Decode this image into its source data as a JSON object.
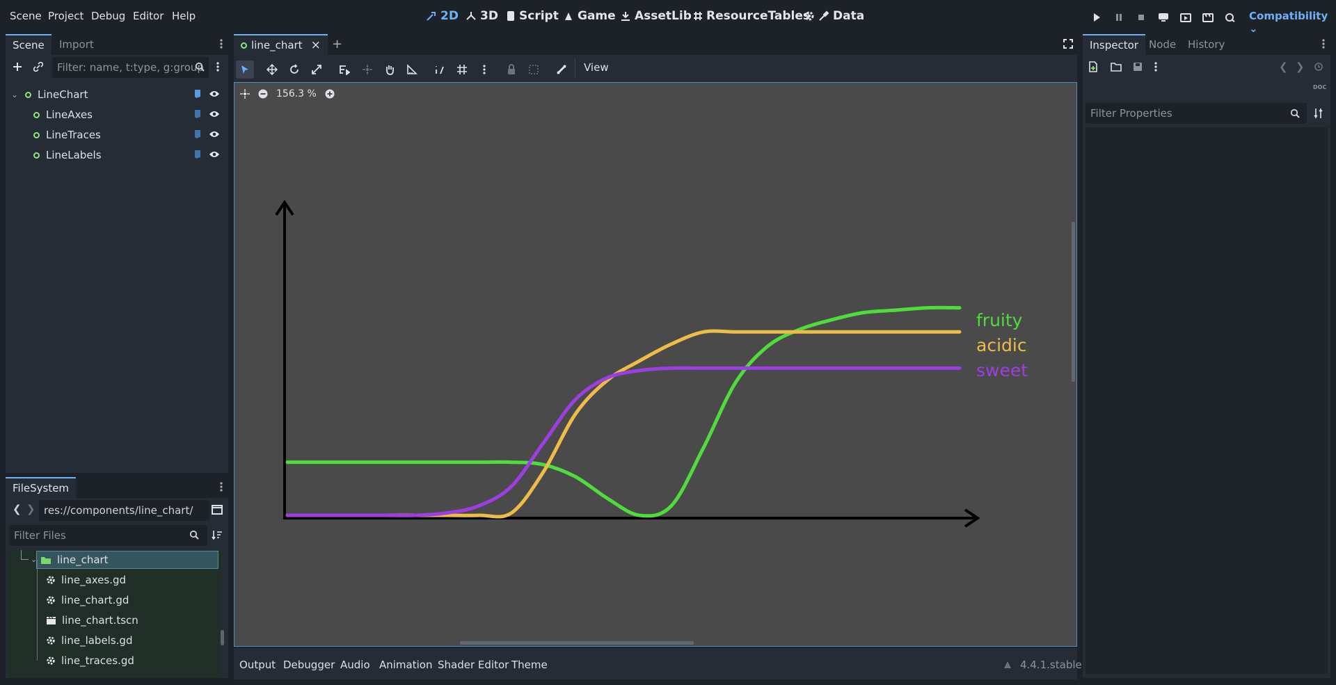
{
  "menu": [
    "Scene",
    "Project",
    "Debug",
    "Editor",
    "Help"
  ],
  "modes": [
    {
      "label": "2D",
      "icon": "2d-icon",
      "active": true
    },
    {
      "label": "3D",
      "icon": "3d-icon",
      "active": false
    },
    {
      "label": "Script",
      "icon": "script-icon",
      "active": false
    },
    {
      "label": "Game",
      "icon": "game-icon",
      "active": false
    },
    {
      "label": "AssetLib",
      "icon": "assetlib-icon",
      "active": false
    },
    {
      "label": "ResourceTables",
      "icon": "hash-icon",
      "active": false
    },
    {
      "label": "Data",
      "icon": "gear-icon",
      "active": false
    }
  ],
  "renderer": "Compatibility",
  "scene_panel": {
    "tabs": [
      "Scene",
      "Import"
    ],
    "filter_placeholder": "Filter: name, t:type, g:group",
    "tree": [
      {
        "label": "LineChart",
        "depth": 0
      },
      {
        "label": "LineAxes",
        "depth": 1
      },
      {
        "label": "LineTraces",
        "depth": 1
      },
      {
        "label": "LineLabels",
        "depth": 1
      }
    ]
  },
  "filesystem": {
    "tab": "FileSystem",
    "path": "res://components/line_chart/",
    "filter_placeholder": "Filter Files",
    "folder": "line_chart",
    "files": [
      {
        "name": "line_axes.gd",
        "icon": "gear-icon"
      },
      {
        "name": "line_chart.gd",
        "icon": "gear-icon"
      },
      {
        "name": "line_chart.tscn",
        "icon": "clapper-icon"
      },
      {
        "name": "line_labels.gd",
        "icon": "gear-icon"
      },
      {
        "name": "line_traces.gd",
        "icon": "gear-icon"
      }
    ]
  },
  "editor": {
    "scene_tab": "line_chart",
    "view_label": "View",
    "zoom": "156.3 %"
  },
  "inspector": {
    "tabs": [
      "Inspector",
      "Node",
      "History"
    ],
    "filter_placeholder": "Filter Properties"
  },
  "bottom_tabs": [
    "Output",
    "Debugger",
    "Audio",
    "Animation",
    "Shader Editor",
    "Theme"
  ],
  "version": "4.4.1.stable",
  "colors": {
    "accent": "#6fb1f5",
    "fruity": "#4fdc3c",
    "acidic": "#eebd47",
    "sweet": "#9c3ee2"
  },
  "chart_data": {
    "type": "line",
    "title": "",
    "xlabel": "",
    "ylabel": "",
    "legend_position": "right",
    "series": [
      {
        "name": "fruity",
        "color": "#4fdc3c",
        "values": [
          0.22,
          0.22,
          0.22,
          0.22,
          0.22,
          0.22,
          0.22,
          0.22,
          0.21,
          0.16,
          0.07,
          0.0,
          0.04,
          0.28,
          0.55,
          0.7,
          0.77,
          0.81,
          0.84,
          0.85,
          0.86,
          0.86
        ]
      },
      {
        "name": "acidic",
        "color": "#eebd47",
        "values": [
          0.0,
          0.0,
          0.0,
          0.0,
          0.0,
          0.0,
          0.0,
          0.01,
          0.18,
          0.42,
          0.56,
          0.64,
          0.71,
          0.76,
          0.76,
          0.76,
          0.76,
          0.76,
          0.76,
          0.76,
          0.76,
          0.76
        ]
      },
      {
        "name": "sweet",
        "color": "#9c3ee2",
        "values": [
          0.0,
          0.0,
          0.0,
          0.0,
          0.0,
          0.01,
          0.04,
          0.12,
          0.3,
          0.48,
          0.57,
          0.6,
          0.61,
          0.61,
          0.61,
          0.61,
          0.61,
          0.61,
          0.61,
          0.61,
          0.61,
          0.61
        ]
      }
    ]
  }
}
